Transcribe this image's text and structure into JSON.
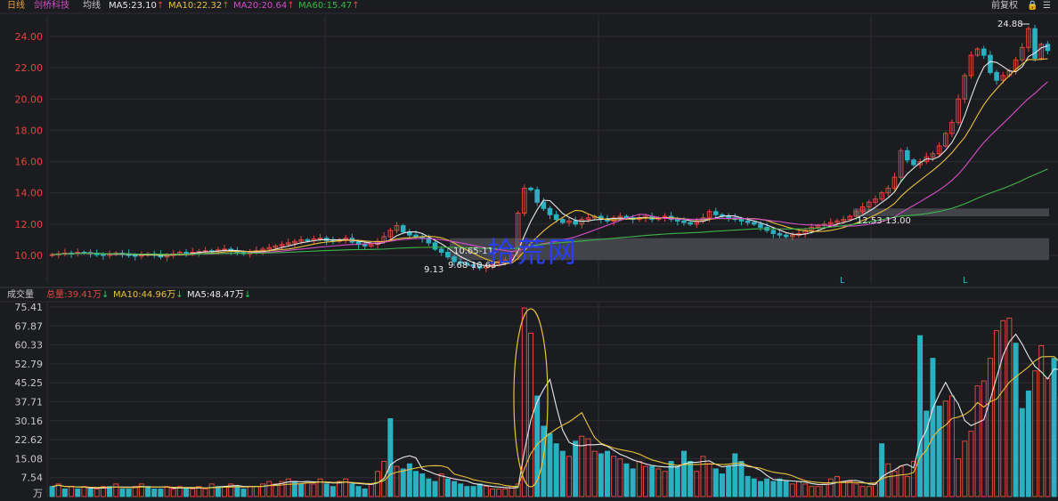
{
  "header": {
    "period": "日线",
    "stock_name": "剑桥科技",
    "indicator": "均线",
    "ma5": "MA5:23.10",
    "ma10": "MA10:22.32",
    "ma20": "MA20:20.64",
    "ma60": "MA60:15.47",
    "up_arrow": "↑",
    "adjust": "前复权",
    "lock_icon": "lock-icon",
    "menu_icon": "menu-icon"
  },
  "volume_header": {
    "title": "成交量",
    "total": "总量:39.41万",
    "ma10": "MA10:44.96万",
    "ma5": "MA5:48.47万",
    "down_arrow": "↓"
  },
  "watermark": "拾荒网",
  "colors": {
    "up": "#e2463f",
    "down": "#2bb0c0",
    "ma5": "#e8e8e8",
    "ma10": "#e8c23a",
    "ma20": "#d44ec8",
    "ma60": "#3cb44a",
    "background": "#1b1c20",
    "grid": "#2c2d33"
  },
  "chart_data": [
    {
      "type": "candlestick",
      "title": "剑桥科技",
      "ylim": [
        9.0,
        25.0
      ],
      "y_ticks": [
        "24.00",
        "22.00",
        "20.00",
        "18.00",
        "16.00",
        "14.00",
        "12.00",
        "10.00"
      ],
      "grid": true,
      "annotations": [
        {
          "text": "24.88",
          "at_value": 24.88
        },
        {
          "text": "9.13",
          "at_value": 9.13
        },
        {
          "text": "9.68-10.63",
          "range": [
            9.68,
            10.63
          ]
        },
        {
          "text": "10.65-11.",
          "range": [
            10.65,
            11.0
          ]
        },
        {
          "text": "12.53-13.00",
          "range": [
            12.53,
            13.0
          ]
        },
        {
          "text": "L"
        },
        {
          "text": "L"
        }
      ],
      "support_zones": [
        [
          12.5,
          13.0
        ],
        [
          9.7,
          11.1
        ]
      ],
      "series_close": [
        10.05,
        10.1,
        10.15,
        10.12,
        10.2,
        10.18,
        10.1,
        10.05,
        10.0,
        10.08,
        10.15,
        10.1,
        10.0,
        9.95,
        10.02,
        10.1,
        10.05,
        9.9,
        10.0,
        10.1,
        10.2,
        10.15,
        10.2,
        10.25,
        10.3,
        10.28,
        10.35,
        10.4,
        10.3,
        10.2,
        10.1,
        10.2,
        10.3,
        10.4,
        10.5,
        10.6,
        10.7,
        10.8,
        10.9,
        11.0,
        10.95,
        11.05,
        11.1,
        10.95,
        10.9,
        11.0,
        11.1,
        10.85,
        10.7,
        10.6,
        10.7,
        10.9,
        11.2,
        11.6,
        11.9,
        11.5,
        11.3,
        11.2,
        11.1,
        10.8,
        10.4,
        10.2,
        9.9,
        9.6,
        9.5,
        9.4,
        9.3,
        9.2,
        9.3,
        9.4,
        9.6,
        9.7,
        10.0,
        12.7,
        14.3,
        14.2,
        13.4,
        13.0,
        12.6,
        12.3,
        12.1,
        12.2,
        12.0,
        12.3,
        12.4,
        12.5,
        12.3,
        12.2,
        12.4,
        12.5,
        12.4,
        12.3,
        12.4,
        12.5,
        12.3,
        12.4,
        12.5,
        12.3,
        12.2,
        12.1,
        12.0,
        12.2,
        12.4,
        12.8,
        12.6,
        12.5,
        12.4,
        12.3,
        12.2,
        12.1,
        12.0,
        11.8,
        11.6,
        11.4,
        11.3,
        11.2,
        11.3,
        11.4,
        11.6,
        11.8,
        11.9,
        12.0,
        12.1,
        12.2,
        12.3,
        12.5,
        12.8,
        13.1,
        13.4,
        13.6,
        14.0,
        14.3,
        15.0,
        16.7,
        16.1,
        15.8,
        16.0,
        16.3,
        16.5,
        17.0,
        17.8,
        18.5,
        20.0,
        21.5,
        22.8,
        23.2,
        22.8,
        21.7,
        21.2,
        21.5,
        21.8,
        22.5,
        23.3,
        24.5,
        22.6,
        23.5,
        23.1
      ],
      "ma_series": [
        "MA5",
        "MA10",
        "MA20",
        "MA60"
      ]
    },
    {
      "type": "bar",
      "title": "成交量",
      "unit": "万",
      "ylim": [
        0,
        75.41
      ],
      "y_ticks": [
        "75.41",
        "67.87",
        "60.33",
        "52.79",
        "45.25",
        "37.71",
        "30.16",
        "22.62",
        "15.08",
        "7.54",
        "万"
      ],
      "grid": true,
      "values": [
        4,
        5,
        3,
        4,
        3,
        4,
        3,
        3,
        4,
        4,
        5,
        3,
        3,
        4,
        5,
        4,
        3,
        3,
        4,
        3,
        4,
        3,
        3,
        4,
        3,
        5,
        4,
        4,
        5,
        4,
        3,
        4,
        4,
        5,
        6,
        5,
        6,
        7,
        6,
        5,
        6,
        5,
        7,
        5,
        4,
        6,
        7,
        5,
        4,
        3,
        5,
        10,
        14,
        31,
        12,
        11,
        13,
        10,
        9,
        7,
        6,
        9,
        7,
        6,
        5,
        4,
        4,
        5,
        4,
        3,
        3,
        3,
        4,
        5,
        75,
        65,
        40,
        28,
        25,
        21,
        18,
        16,
        22,
        24,
        23,
        18,
        17,
        18,
        16,
        15,
        13,
        11,
        14,
        12,
        12,
        11,
        10,
        14,
        12,
        18,
        14,
        10,
        16,
        13,
        11,
        9,
        12,
        17,
        14,
        8,
        7,
        6,
        7,
        6,
        7,
        6,
        5,
        6,
        5,
        4,
        4,
        5,
        7,
        8,
        6,
        6,
        5,
        4,
        4,
        5,
        21,
        13,
        10,
        12,
        8,
        14,
        64,
        34,
        55,
        36,
        38,
        40,
        15,
        22,
        26,
        44,
        46,
        55,
        66,
        70,
        71,
        61,
        35,
        42,
        50,
        60,
        47,
        55,
        40,
        39
      ],
      "volume_up": [
        false,
        true,
        false,
        true,
        false,
        true,
        false,
        true,
        true,
        false,
        true,
        false,
        false,
        true,
        true,
        false,
        false,
        false,
        true,
        true,
        true,
        false,
        true,
        true,
        true,
        true,
        false,
        true,
        true,
        false,
        false,
        true,
        true,
        true,
        true,
        true,
        true,
        true,
        false,
        false,
        true,
        true,
        true,
        false,
        false,
        true,
        true,
        false,
        false,
        false,
        true,
        true,
        true,
        false,
        true,
        false,
        false,
        false,
        false,
        false,
        false,
        true,
        false,
        false,
        false,
        false,
        false,
        false,
        true,
        true,
        true,
        true,
        true,
        true,
        true,
        true,
        false,
        false,
        false,
        false,
        false,
        true,
        false,
        true,
        true,
        true,
        false,
        false,
        true,
        true,
        false,
        false,
        true,
        true,
        false,
        true,
        true,
        false,
        false,
        false,
        false,
        true,
        true,
        true,
        false,
        false,
        false,
        false,
        false,
        false,
        false,
        false,
        false,
        false,
        false,
        false,
        true,
        true,
        true,
        true,
        true,
        true,
        true,
        true,
        true,
        true,
        true,
        true,
        true,
        true,
        false,
        true,
        true,
        true,
        true,
        true,
        false,
        false,
        false,
        false,
        true,
        true,
        true,
        true,
        true,
        true,
        true,
        true,
        true,
        true,
        true,
        false,
        false,
        false,
        true,
        true,
        true,
        false,
        true,
        true,
        false
      ]
    }
  ]
}
